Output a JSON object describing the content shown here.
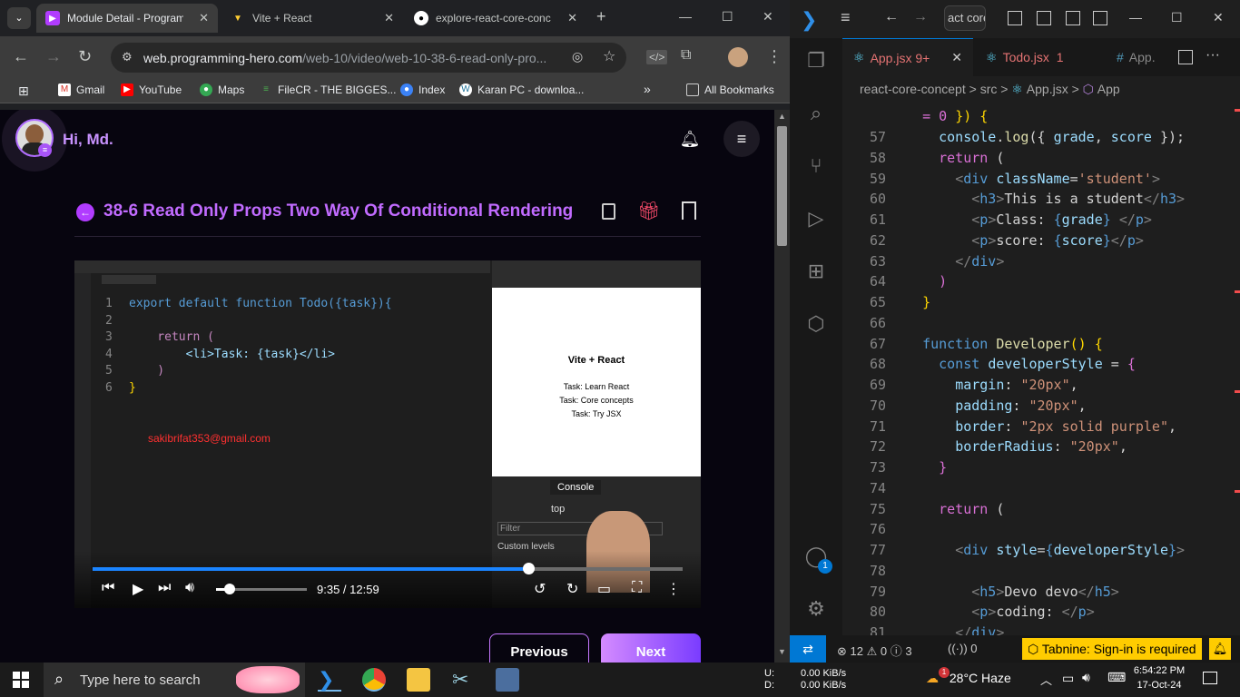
{
  "browser": {
    "tabs": [
      {
        "title": "Module Detail - Programm",
        "active": true
      },
      {
        "title": "Vite + React",
        "active": false
      },
      {
        "title": "explore-react-core-conc",
        "active": false
      }
    ],
    "url_host": "web.programming-hero.com",
    "url_path": "/web-10/video/web-10-38-6-read-only-pro...",
    "bookmarks": [
      "Gmail",
      "YouTube",
      "Maps",
      "FileCR - THE BIGGES...",
      "Index",
      "Karan PC - downloa..."
    ],
    "all_bookmarks": "All Bookmarks",
    "overflow": "»"
  },
  "page": {
    "greeting": "Hi, Md.",
    "video_title": "38-6 Read Only Props Two Way Of Conditional Rendering",
    "video": {
      "time": "9:35 / 12:59",
      "progress": 0.738,
      "volume": 0.15,
      "watermark": "sakibrifat353@gmail.com",
      "code": [
        {
          "n": "1",
          "text": "export default function Todo({task}){"
        },
        {
          "n": "2",
          "text": ""
        },
        {
          "n": "3",
          "text": "    return ("
        },
        {
          "n": "4",
          "text": "        <li>Task: {task}</li>"
        },
        {
          "n": "5",
          "text": "    )"
        },
        {
          "n": "6",
          "text": "}"
        }
      ],
      "preview_title": "Vite + React",
      "preview_items": [
        "Task: Learn React",
        "Task: Core concepts",
        "Task: Try JSX"
      ],
      "console_tab": "Console",
      "console_top": "top",
      "console_filter": "Filter",
      "console_levels": "Custom levels"
    },
    "prev_label": "Previous",
    "next_label": "Next"
  },
  "vscode": {
    "search": "act core",
    "tabs": [
      {
        "name": "App.jsx",
        "badge": "9+",
        "active": true
      },
      {
        "name": "Todo.jsx",
        "badge": "1",
        "active": false
      },
      {
        "name": "App.",
        "badge": "",
        "active": false
      }
    ],
    "breadcrumb": [
      "react-core-concept",
      "src",
      "App.jsx",
      "App"
    ],
    "account_badge": "1",
    "status": {
      "errors": "12",
      "warnings": "0",
      "info": "3",
      "ports": "0",
      "tabnine": "Tabnine: Sign-in is required"
    }
  },
  "taskbar": {
    "search_placeholder": "Type here to search",
    "net_up": "0.00 KiB/s",
    "net_down": "0.00 KiB/s",
    "drive_u": "U:",
    "drive_d": "D:",
    "weather": "28°C  Haze",
    "time": "6:54:22 PM",
    "date": "17-Oct-24",
    "weather_badge": "1"
  }
}
